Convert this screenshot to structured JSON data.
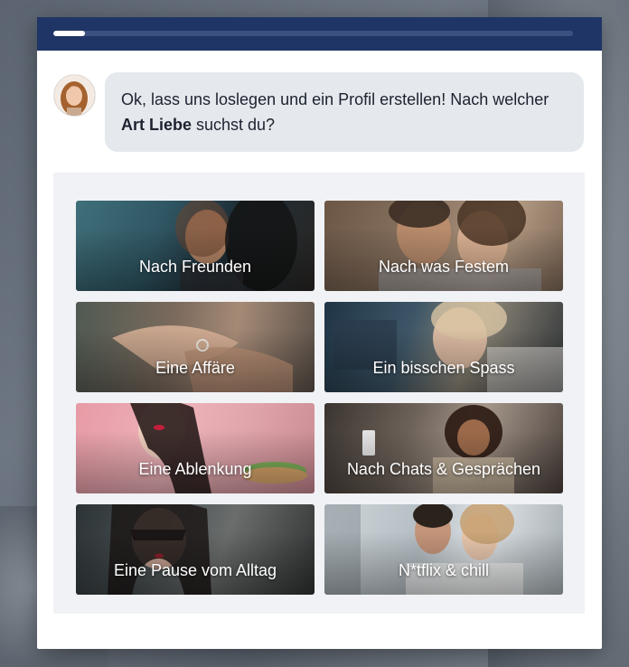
{
  "progress": {
    "fraction": 0.06
  },
  "chat": {
    "avatar_icon": "woman-avatar",
    "message_before": "Ok, lass uns loslegen und ein Profil erstellen! Nach welcher ",
    "message_bold": "Art Liebe",
    "message_after": " suchst du?"
  },
  "options": [
    {
      "label": "Nach Freunden",
      "photo": "couple-kiss"
    },
    {
      "label": "Nach was Festem",
      "photo": "smiling-couple"
    },
    {
      "label": "Eine Affäre",
      "photo": "hands-ring"
    },
    {
      "label": "Ein bisschen Spass",
      "photo": "woman-in-car"
    },
    {
      "label": "Eine Ablenkung",
      "photo": "woman-pink-eclair"
    },
    {
      "label": "Nach Chats & Gesprächen",
      "photo": "woman-phone"
    },
    {
      "label": "Eine Pause vom Alltag",
      "photo": "masked-woman"
    },
    {
      "label": "N*tflix & chill",
      "photo": "couple-window"
    }
  ]
}
